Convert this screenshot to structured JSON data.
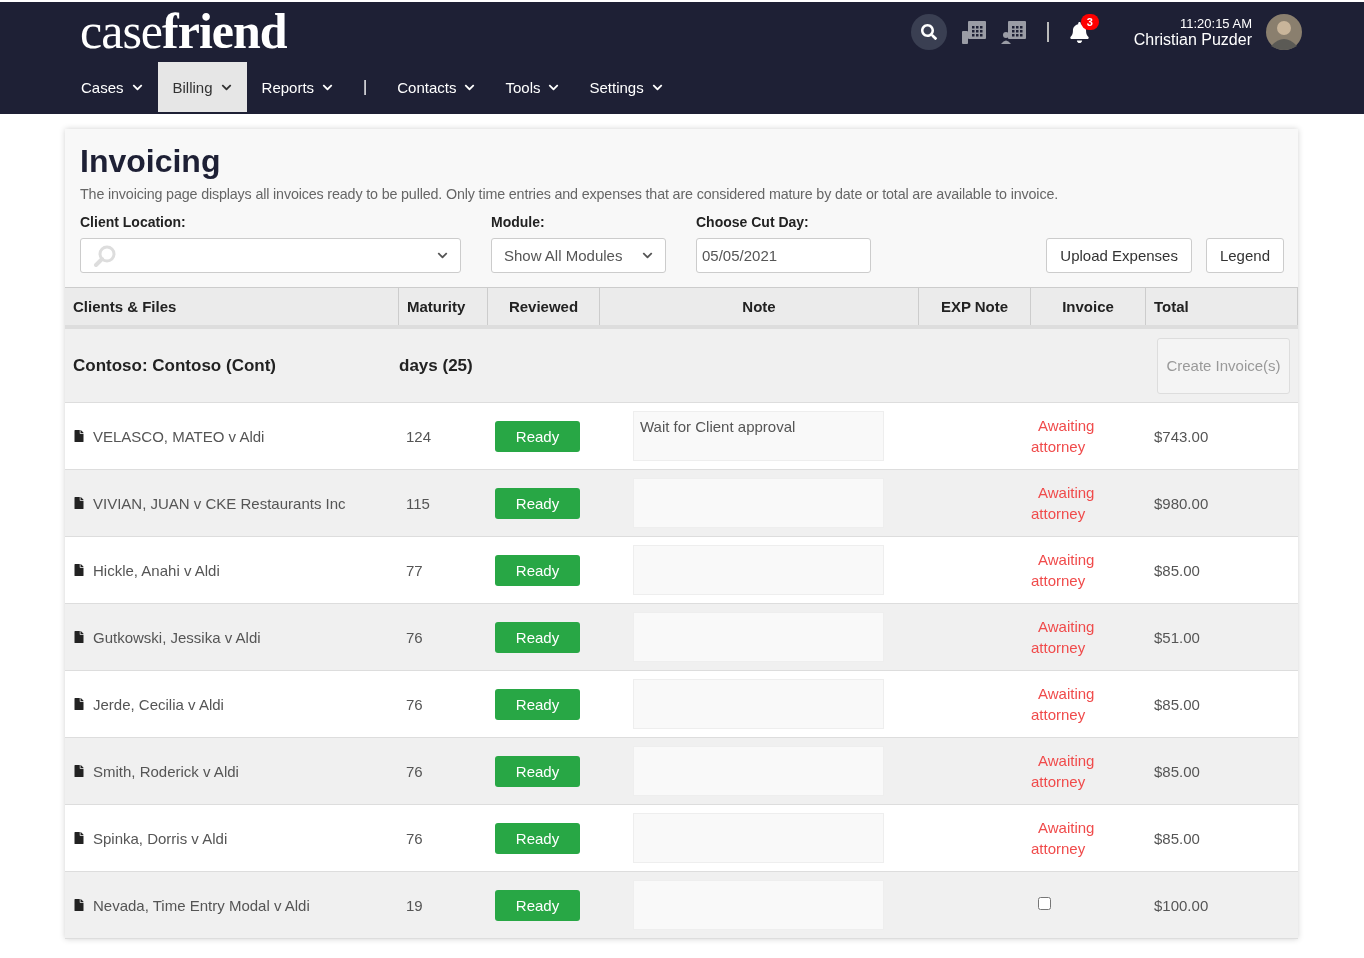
{
  "header": {
    "logo": "case**friend**",
    "notifications": "3",
    "time": "11:20:15 AM",
    "user": "Christian Puzder"
  },
  "nav": [
    {
      "label": "Cases",
      "selected": false,
      "kind": "menu"
    },
    {
      "label": "Billing",
      "selected": true,
      "kind": "menu"
    },
    {
      "label": "Reports",
      "selected": false,
      "kind": "menu"
    },
    {
      "label": "|",
      "kind": "separator"
    },
    {
      "label": "Contacts",
      "selected": false,
      "kind": "menu"
    },
    {
      "label": "Tools",
      "selected": false,
      "kind": "menu"
    },
    {
      "label": "Settings",
      "selected": false,
      "kind": "menu"
    }
  ],
  "page": {
    "title": "Invoicing",
    "description": "The invoicing page displays all invoices ready to be pulled. Only time entries and expenses that are considered mature by date or total are available to invoice."
  },
  "filters": {
    "client_location": {
      "label": "Client Location:"
    },
    "module": {
      "label": "Module:",
      "value": "Show All Modules"
    },
    "cut_day": {
      "label": "Choose Cut Day:",
      "value": "05/05/2021"
    }
  },
  "buttons": [
    "Upload Expenses",
    "Legend"
  ],
  "table": {
    "columns": [
      "Clients & Files",
      "Maturity",
      "Reviewed",
      "Note",
      "EXP Note",
      "Invoice",
      "Total"
    ],
    "group": {
      "client": "Contoso: Contoso (Cont)",
      "maturity": "days (25)",
      "action": "Create Invoice(s)",
      "action_disabled": true
    },
    "rows": [
      {
        "file": "VELASCO, MATEO v Aldi",
        "maturity": "124",
        "reviewed": "Ready",
        "note": "Wait for Client approval",
        "invoice": {
          "kind": "status",
          "text": "Awaiting attorney"
        },
        "total": "$743.00"
      },
      {
        "file": "VIVIAN, JUAN v CKE Restaurants Inc",
        "maturity": "115",
        "reviewed": "Ready",
        "invoice": {
          "kind": "status",
          "text": "Awaiting attorney"
        },
        "total": "$980.00"
      },
      {
        "file": "Hickle, Anahi v Aldi",
        "maturity": "77",
        "reviewed": "Ready",
        "invoice": {
          "kind": "status",
          "text": "Awaiting attorney"
        },
        "total": "$85.00"
      },
      {
        "file": "Gutkowski, Jessika v Aldi",
        "maturity": "76",
        "reviewed": "Ready",
        "invoice": {
          "kind": "status",
          "text": "Awaiting attorney"
        },
        "total": "$51.00"
      },
      {
        "file": "Jerde, Cecilia v Aldi",
        "maturity": "76",
        "reviewed": "Ready",
        "invoice": {
          "kind": "status",
          "text": "Awaiting attorney"
        },
        "total": "$85.00"
      },
      {
        "file": "Smith, Roderick v Aldi",
        "maturity": "76",
        "reviewed": "Ready",
        "invoice": {
          "kind": "status",
          "text": "Awaiting attorney"
        },
        "total": "$85.00"
      },
      {
        "file": "Spinka, Dorris v Aldi",
        "maturity": "76",
        "reviewed": "Ready",
        "invoice": {
          "kind": "status",
          "text": "Awaiting attorney"
        },
        "total": "$85.00"
      },
      {
        "file": "Nevada, Time Entry Modal v Aldi",
        "maturity": "19",
        "reviewed": "Ready",
        "invoice": {
          "kind": "checkbox",
          "checked": false
        },
        "total": "$100.00"
      }
    ]
  }
}
